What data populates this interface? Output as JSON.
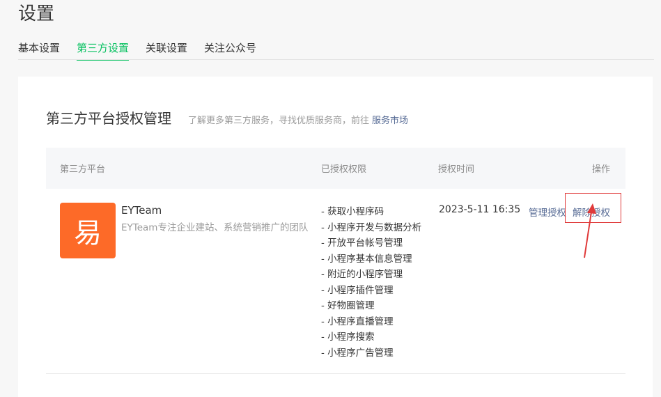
{
  "page": {
    "title": "设置"
  },
  "tabs": [
    {
      "label": "基本设置",
      "active": false
    },
    {
      "label": "第三方设置",
      "active": true
    },
    {
      "label": "关联设置",
      "active": false
    },
    {
      "label": "关注公众号",
      "active": false
    }
  ],
  "section": {
    "title": "第三方平台授权管理",
    "description": "了解更多第三方服务，寻找优质服务商，前往",
    "link_label": "服务市场"
  },
  "table": {
    "headers": {
      "platform": "第三方平台",
      "permissions": "已授权权限",
      "auth_time": "授权时间",
      "actions": "操作"
    },
    "rows": [
      {
        "logo_glyph": "易",
        "name": "EYTeam",
        "description": "EYTeam专注企业建站、系统营销推广的团队",
        "permissions": [
          "- 获取小程序码",
          "- 小程序开发与数据分析",
          "- 开放平台帐号管理",
          "- 小程序基本信息管理",
          "- 附近的小程序管理",
          "- 小程序插件管理",
          "- 好物圈管理",
          "- 小程序直播管理",
          "- 小程序搜索",
          "- 小程序广告管理"
        ],
        "auth_time": "2023-5-11 16:35",
        "actions": {
          "manage": "管理授权",
          "revoke": "解除授权"
        }
      }
    ]
  },
  "colors": {
    "accent": "#07c160",
    "link": "#576b95",
    "logo_bg": "#fd6a28",
    "annotation": "#e03a3a"
  }
}
